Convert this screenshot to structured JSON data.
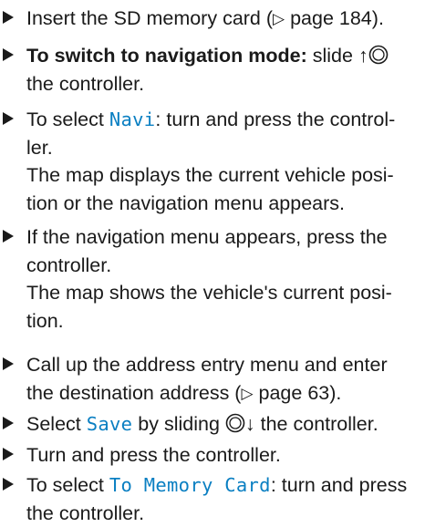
{
  "steps": [
    {
      "lines": [
        {
          "text": "Insert the SD memory card ("
        },
        {
          "ref": "page 184"
        },
        {
          "tail": ")."
        }
      ]
    },
    {
      "bold": "To switch to navigation mode:",
      "text1": " slide ",
      "text2": "the controller."
    },
    {
      "pre": "To select ",
      "ui": "Navi",
      "post": ": turn and press the control-",
      "l2": "ler.",
      "l3": "The map displays the current vehicle posi-",
      "l4": "tion or the navigation menu appears."
    },
    {
      "l1": "If the navigation menu appears, press the",
      "l2": "controller.",
      "l3": "The map shows the vehicle's current posi-",
      "l4": "tion."
    },
    {
      "l1": "Call up the address entry menu and enter",
      "l2a": "the destination address (",
      "ref": "page 63",
      "l2b": ")."
    },
    {
      "pre": "Select ",
      "ui": "Save",
      "post1": " by sliding ",
      "post2": " the controller."
    },
    {
      "l1": "Turn and press the controller."
    },
    {
      "pre": "To select ",
      "ui": "To Memory Card",
      "post": ": turn and press",
      "l2": "the controller."
    }
  ],
  "icons": {
    "bullet": "play-triangle-icon",
    "page_ref": "page-reference-triangle-icon",
    "controller": "controller-knob-icon"
  },
  "colors": {
    "text": "#1a1a1a",
    "ui_term": "#0a7fc2"
  }
}
